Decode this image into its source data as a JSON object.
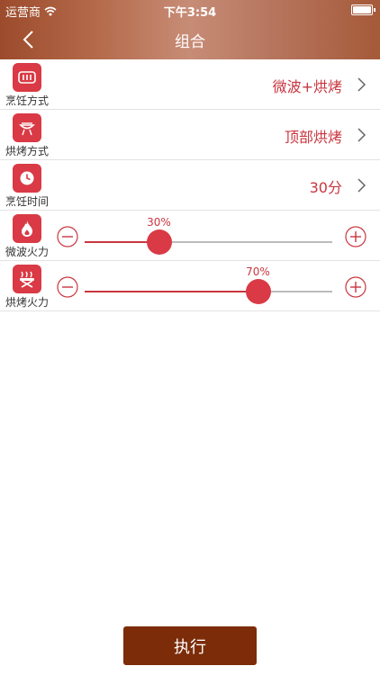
{
  "status": {
    "carrier": "运营商",
    "time": "下午3:54"
  },
  "nav": {
    "title": "组合"
  },
  "rows": [
    {
      "label": "烹饪方式",
      "value": "微波+烘烤",
      "icon": "microwave-icon"
    },
    {
      "label": "烘烤方式",
      "value": "顶部烘烤",
      "icon": "grill-icon"
    },
    {
      "label": "烹饪时间",
      "value": "30分",
      "icon": "clock-icon"
    }
  ],
  "sliders": [
    {
      "label": "微波火力",
      "percent_text": "30%",
      "value": 0.3,
      "icon": "flame-icon"
    },
    {
      "label": "烘烤火力",
      "percent_text": "70%",
      "value": 0.7,
      "icon": "barbecue-icon"
    }
  ],
  "execute_label": "执行",
  "colors": {
    "accent": "#d93a45",
    "value_text": "#c9363f",
    "button": "#7c2c08"
  }
}
